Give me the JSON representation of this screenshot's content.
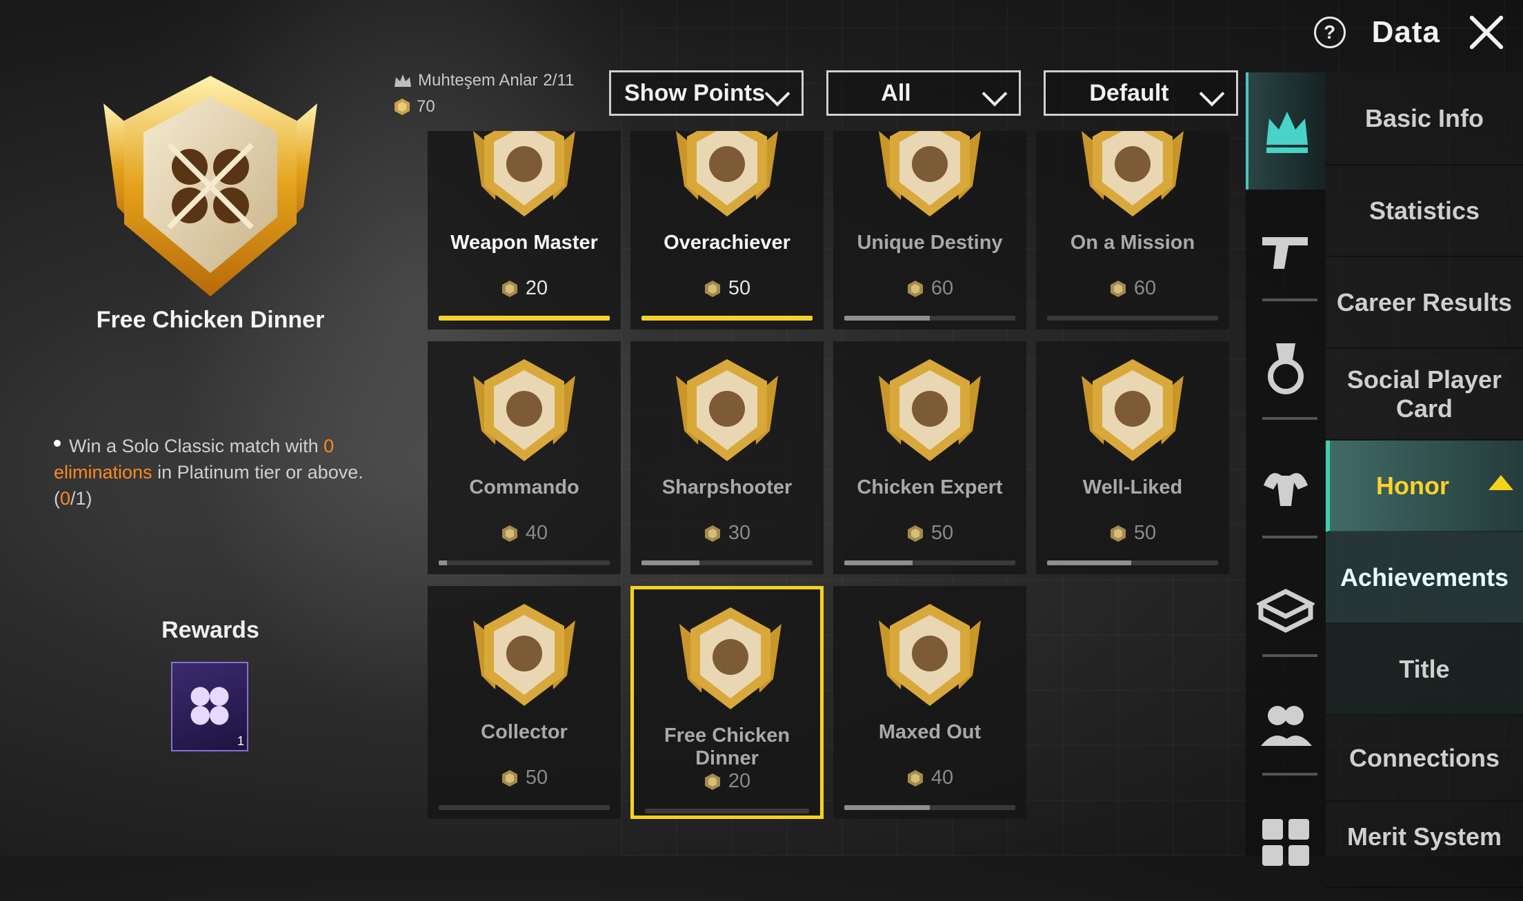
{
  "topbar": {
    "help_icon": "question-circle-icon",
    "data_label": "Data",
    "close_icon": "close-icon"
  },
  "selected": {
    "name": "Free Chicken Dinner",
    "desc_prefix": "Win a Solo Classic match with ",
    "desc_highlight1": "0 eliminations",
    "desc_middle": " in Platinum tier or above. (",
    "desc_highlight2": "0",
    "desc_suffix": "/1)",
    "rewards_title": "Rewards",
    "reward_qty": "1",
    "reward_icon": "clover-icon"
  },
  "summary": {
    "category": "Muhteşem Anlar",
    "progress": "2/11",
    "points": "70"
  },
  "filters": {
    "sort_points": "Show Points",
    "category": "All",
    "order": "Default"
  },
  "achievements": [
    {
      "name": "Weapon Master",
      "points": "20",
      "progress": 1.0,
      "completed": true,
      "icon": "parachute-figure-icon"
    },
    {
      "name": "Overachiever",
      "points": "50",
      "progress": 1.0,
      "completed": true,
      "icon": "trophy-icon"
    },
    {
      "name": "Unique Destiny",
      "points": "60",
      "progress": 0.5,
      "completed": false,
      "icon": "diamond-icon"
    },
    {
      "name": "On a Mission",
      "points": "60",
      "progress": 0.0,
      "completed": false,
      "icon": "crosshair-rifle-icon"
    },
    {
      "name": "Commando",
      "points": "40",
      "progress": 0.05,
      "completed": false,
      "icon": "soldier-icon"
    },
    {
      "name": "Sharpshooter",
      "points": "30",
      "progress": 0.34,
      "completed": false,
      "icon": "helmet-icon"
    },
    {
      "name": "Chicken Expert",
      "points": "50",
      "progress": 0.4,
      "completed": false,
      "icon": "chicken-icon"
    },
    {
      "name": "Well-Liked",
      "points": "50",
      "progress": 0.49,
      "completed": false,
      "icon": "thumbs-up-icon"
    },
    {
      "name": "Collector",
      "points": "50",
      "progress": 0.0,
      "completed": false,
      "icon": "outfit-icon"
    },
    {
      "name": "Free Chicken Dinner",
      "points": "20",
      "progress": 0.0,
      "completed": false,
      "selected": true,
      "icon": "clover-icon"
    },
    {
      "name": "Maxed Out",
      "points": "40",
      "progress": 0.5,
      "completed": false,
      "icon": "rank-chevron-icon"
    }
  ],
  "side_icons": [
    "crown-icon",
    "pistol-icon",
    "medal-icon",
    "flex-arm-icon",
    "crate-icon",
    "friends-icon",
    "grid-icon"
  ],
  "menu": {
    "basic_info": "Basic Info",
    "statistics": "Statistics",
    "career_results": "Career Results",
    "social_card": "Social Player Card",
    "honor": "Honor",
    "achievements": "Achievements",
    "title": "Title",
    "connections": "Connections",
    "merit_system": "Merit System"
  },
  "colors": {
    "accent_yellow": "#f7d21d",
    "highlight_orange": "#ff8a1e",
    "teal": "#49c6c0"
  }
}
